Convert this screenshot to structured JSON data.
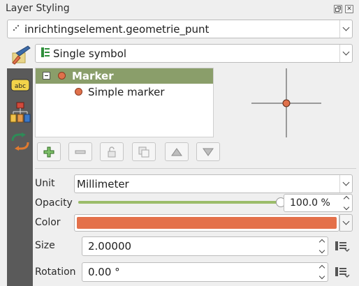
{
  "panel": {
    "title": "Layer Styling"
  },
  "layer_select": {
    "value": "inrichtingselement.geometrie_punt"
  },
  "renderer_select": {
    "value": "Single symbol"
  },
  "tree": {
    "items": [
      {
        "label": "Marker"
      },
      {
        "label": "Simple marker"
      }
    ]
  },
  "unit": {
    "label": "Unit",
    "value": "Millimeter"
  },
  "opacity": {
    "label": "Opacity",
    "value": "100.0 %",
    "level": 1.0
  },
  "color": {
    "label": "Color",
    "swatch": "#e4704a"
  },
  "size": {
    "label": "Size",
    "value": "2.00000"
  },
  "rotation": {
    "label": "Rotation",
    "value": "0.00 °"
  },
  "colors": {
    "accent_row": "#8a9e6a",
    "marker_fill": "#e0714b",
    "sidebar": "#5a5a5a"
  },
  "icons": [
    "float-icon",
    "close-icon",
    "point-layer-icon",
    "single-symbol-icon",
    "paintbrush-icon",
    "labels-abc-icon",
    "diagram-icon",
    "history-icon",
    "add-icon",
    "remove-icon",
    "lock-icon",
    "duplicate-icon",
    "move-up-icon",
    "move-down-icon",
    "data-defined-icon"
  ]
}
